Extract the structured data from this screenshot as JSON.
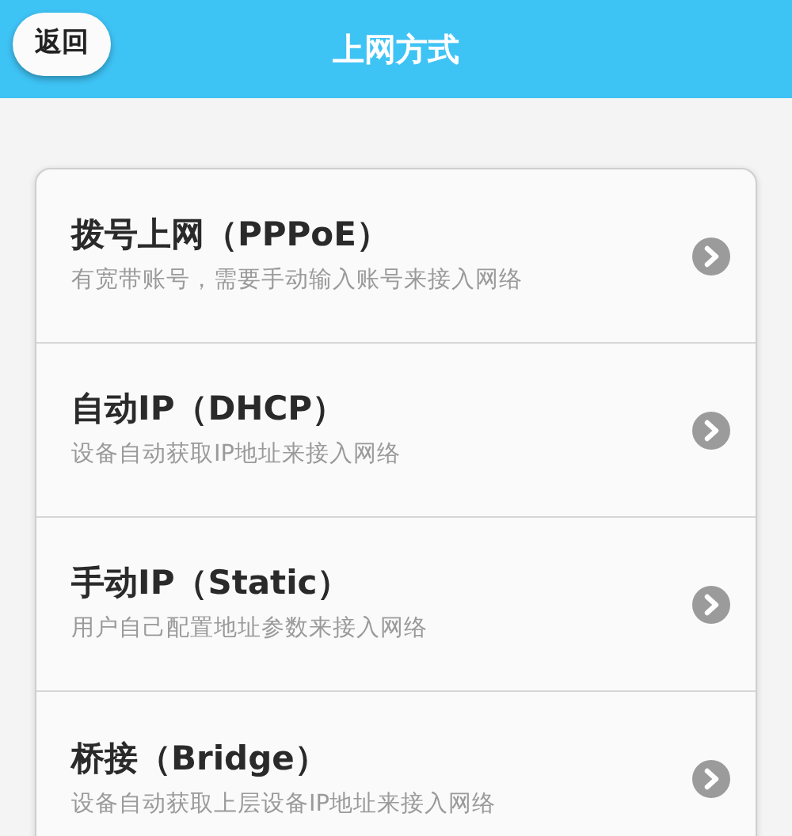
{
  "header": {
    "back_button": "返回",
    "title": "上网方式"
  },
  "options": [
    {
      "title": "拨号上网（PPPoE）",
      "description": "有宽带账号，需要手动输入账号来接入网络"
    },
    {
      "title": "自动IP（DHCP）",
      "description": "设备自动获取IP地址来接入网络"
    },
    {
      "title": "手动IP（Static）",
      "description": "用户自己配置地址参数来接入网络"
    },
    {
      "title": "桥接（Bridge）",
      "description": "设备自动获取上层设备IP地址来接入网络"
    }
  ]
}
